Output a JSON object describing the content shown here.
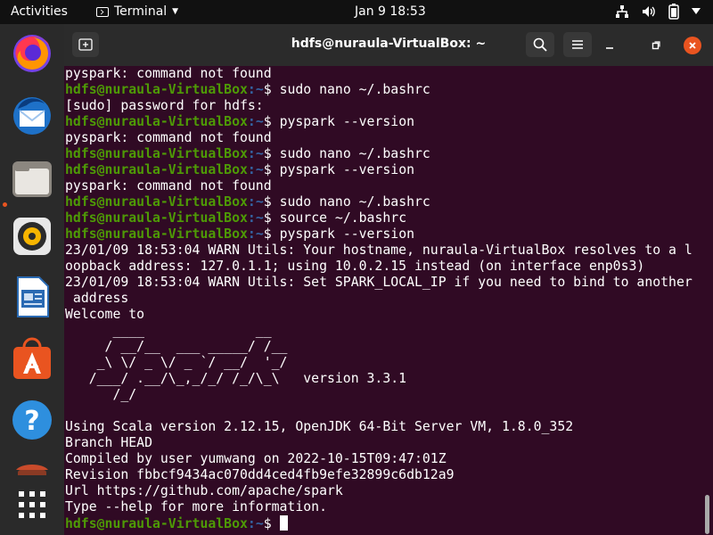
{
  "topbar": {
    "activities": "Activities",
    "app_name": "Terminal",
    "clock": "Jan 9  18:53",
    "icons": [
      "network-icon",
      "volume-icon",
      "battery-icon",
      "system-menu-icon"
    ]
  },
  "dock": {
    "items": [
      "firefox",
      "thunderbird",
      "files",
      "rhythmbox",
      "libreoffice-writer",
      "ubuntu-software",
      "help",
      "trash",
      "show-applications"
    ]
  },
  "window": {
    "title": "hdfs@nuraula-VirtualBox: ~"
  },
  "prompt": {
    "userhost": "hdfs@nuraula-VirtualBox",
    "path": ":~",
    "symbol": "$ "
  },
  "terminal_lines": [
    {
      "type": "out",
      "text": "pyspark: command not found"
    },
    {
      "type": "cmd",
      "text": "sudo nano ~/.bashrc"
    },
    {
      "type": "out",
      "text": "[sudo] password for hdfs:"
    },
    {
      "type": "cmd",
      "text": "pyspark --version"
    },
    {
      "type": "out",
      "text": "pyspark: command not found"
    },
    {
      "type": "cmd",
      "text": "sudo nano ~/.bashrc"
    },
    {
      "type": "cmd",
      "text": "pyspark --version"
    },
    {
      "type": "out",
      "text": "pyspark: command not found"
    },
    {
      "type": "cmd",
      "text": "sudo nano ~/.bashrc"
    },
    {
      "type": "cmd",
      "text": "source ~/.bashrc"
    },
    {
      "type": "cmd",
      "text": "pyspark --version"
    },
    {
      "type": "out",
      "text": "23/01/09 18:53:04 WARN Utils: Your hostname, nuraula-VirtualBox resolves to a l"
    },
    {
      "type": "out",
      "text": "oopback address: 127.0.1.1; using 10.0.2.15 instead (on interface enp0s3)"
    },
    {
      "type": "out",
      "text": "23/01/09 18:53:04 WARN Utils: Set SPARK_LOCAL_IP if you need to bind to another"
    },
    {
      "type": "out",
      "text": " address"
    },
    {
      "type": "out",
      "text": "Welcome to"
    },
    {
      "type": "out",
      "text": "      ____              __"
    },
    {
      "type": "out",
      "text": "     / __/__  ___ _____/ /__"
    },
    {
      "type": "out",
      "text": "    _\\ \\/ _ \\/ _ `/ __/  '_/"
    },
    {
      "type": "out",
      "text": "   /___/ .__/\\_,_/_/ /_/\\_\\   version 3.3.1"
    },
    {
      "type": "out",
      "text": "      /_/"
    },
    {
      "type": "out",
      "text": ""
    },
    {
      "type": "out",
      "text": "Using Scala version 2.12.15, OpenJDK 64-Bit Server VM, 1.8.0_352"
    },
    {
      "type": "out",
      "text": "Branch HEAD"
    },
    {
      "type": "out",
      "text": "Compiled by user yumwang on 2022-10-15T09:47:01Z"
    },
    {
      "type": "out",
      "text": "Revision fbbcf9434ac070dd4ced4fb9efe32899c6db12a9"
    },
    {
      "type": "out",
      "text": "Url https://github.com/apache/spark"
    },
    {
      "type": "out",
      "text": "Type --help for more information."
    },
    {
      "type": "prompt",
      "text": ""
    }
  ],
  "colors": {
    "terminal_bg": "#300a24",
    "prompt_userhost": "#4e9a06",
    "prompt_path": "#3465a4",
    "close_button": "#e95420"
  }
}
